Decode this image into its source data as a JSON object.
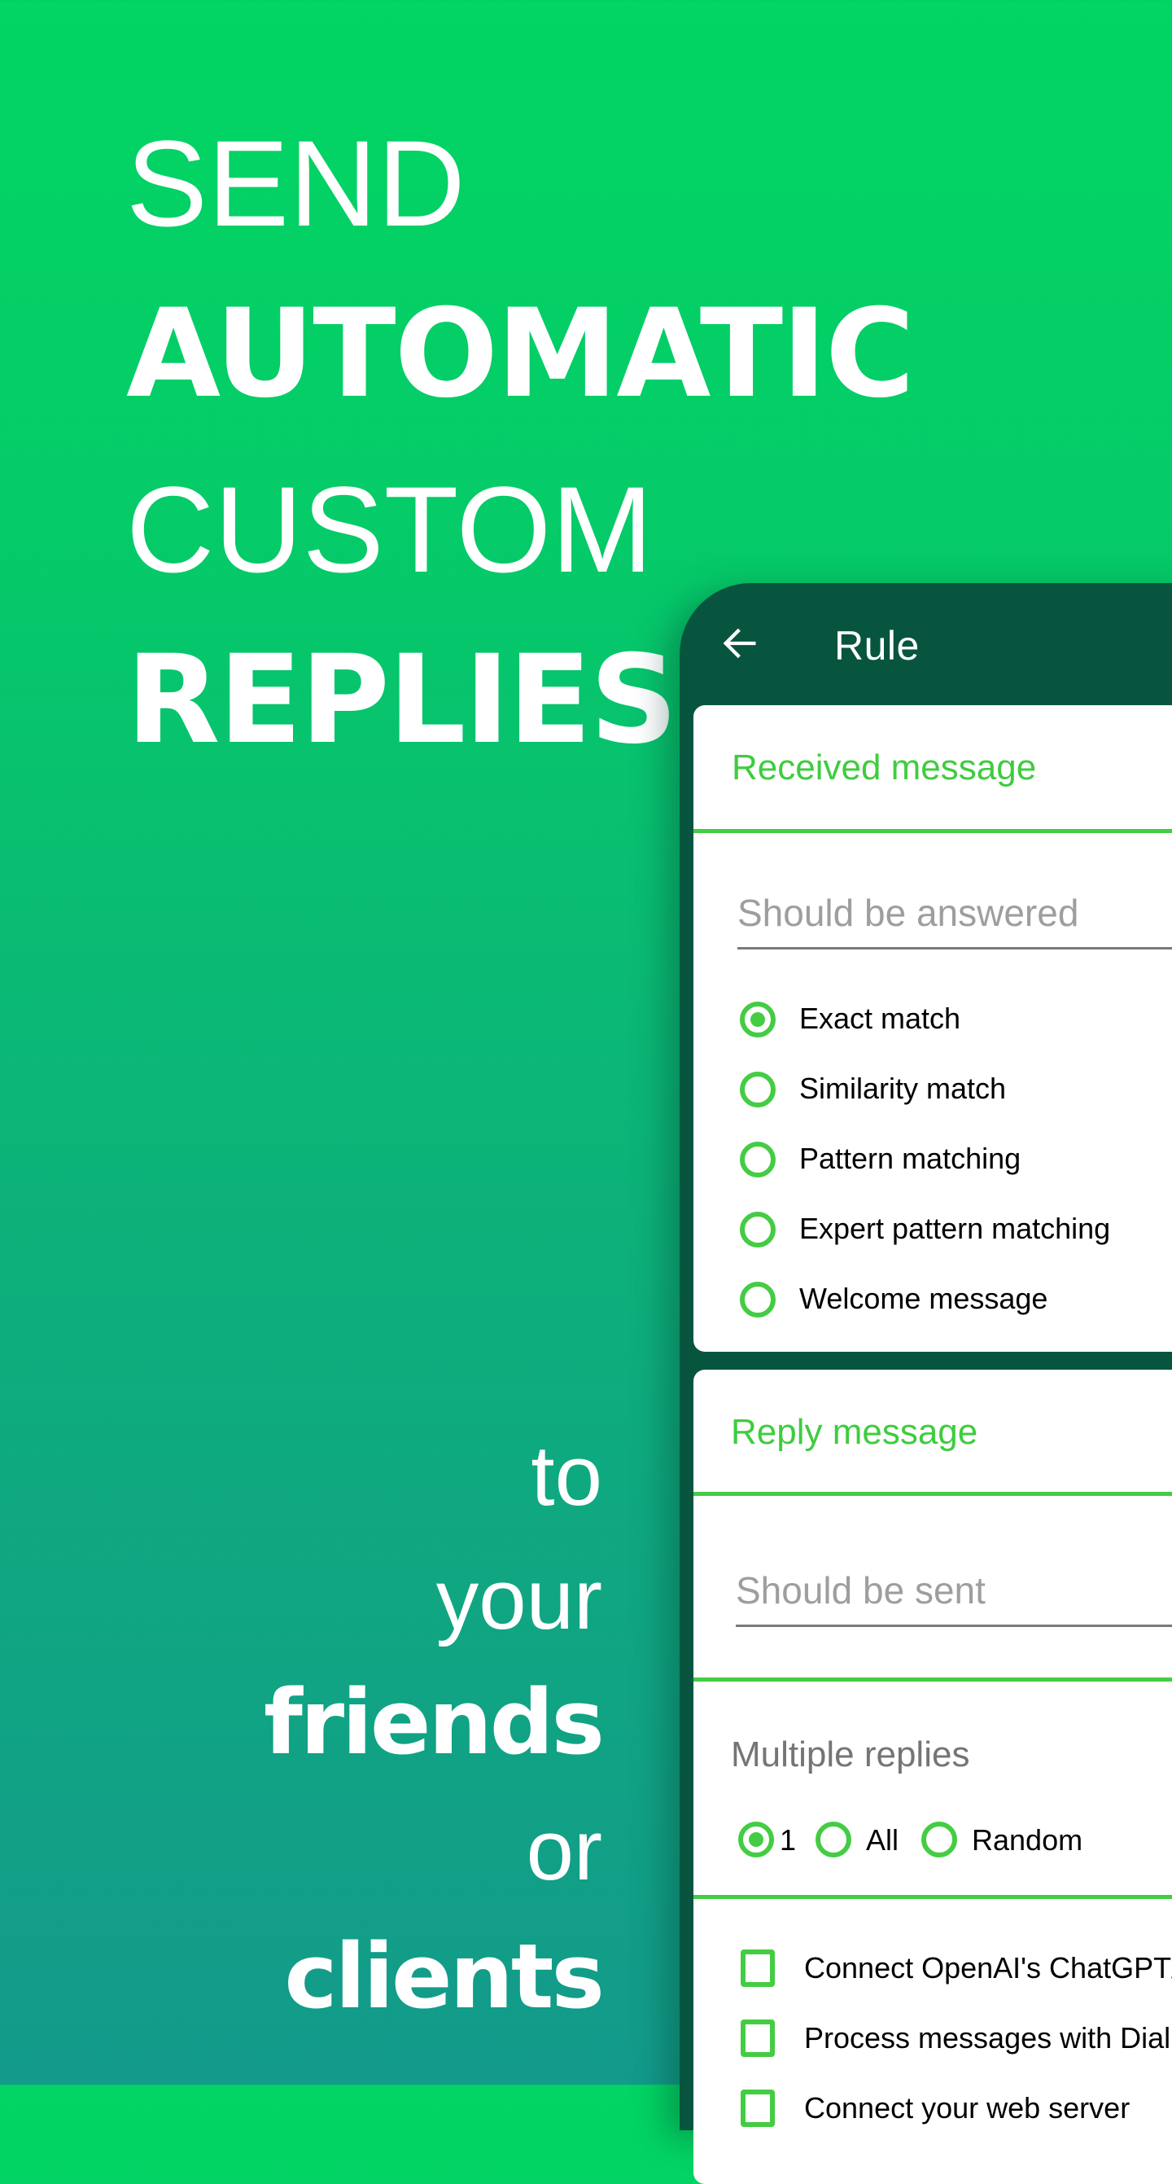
{
  "promo": {
    "headline": [
      "SEND",
      "AUTOMATIC",
      "CUSTOM",
      "REPLIES"
    ],
    "subline": [
      "to",
      "your",
      "friends",
      "or",
      "clients"
    ]
  },
  "colors": {
    "bg_top": "#02D563",
    "bg_bottom": "#139A8B",
    "toolbar": "#07553F",
    "accent": "#44CC44",
    "hint": "#9E9E9E"
  },
  "app": {
    "toolbar": {
      "back_icon": "arrow-left-icon",
      "title": "Rule"
    },
    "received_card": {
      "header": "Received message",
      "input_placeholder": "Should be answered",
      "match_options": [
        {
          "label": "Exact match",
          "checked": true
        },
        {
          "label": "Similarity match",
          "checked": false
        },
        {
          "label": "Pattern matching",
          "checked": false
        },
        {
          "label": "Expert pattern matching",
          "checked": false
        },
        {
          "label": "Welcome message",
          "checked": false
        }
      ]
    },
    "reply_card": {
      "header": "Reply message",
      "input_placeholder": "Should be sent",
      "multiple_replies_label": "Multiple replies",
      "multiple_options": [
        {
          "label": "1",
          "checked": true
        },
        {
          "label": "All",
          "checked": false
        },
        {
          "label": "Random",
          "checked": false
        }
      ],
      "checkboxes": [
        {
          "label": "Connect OpenAI's ChatGPT/",
          "checked": false
        },
        {
          "label": "Process messages with Dial",
          "checked": false
        },
        {
          "label": "Connect your web server",
          "checked": false
        }
      ]
    }
  }
}
